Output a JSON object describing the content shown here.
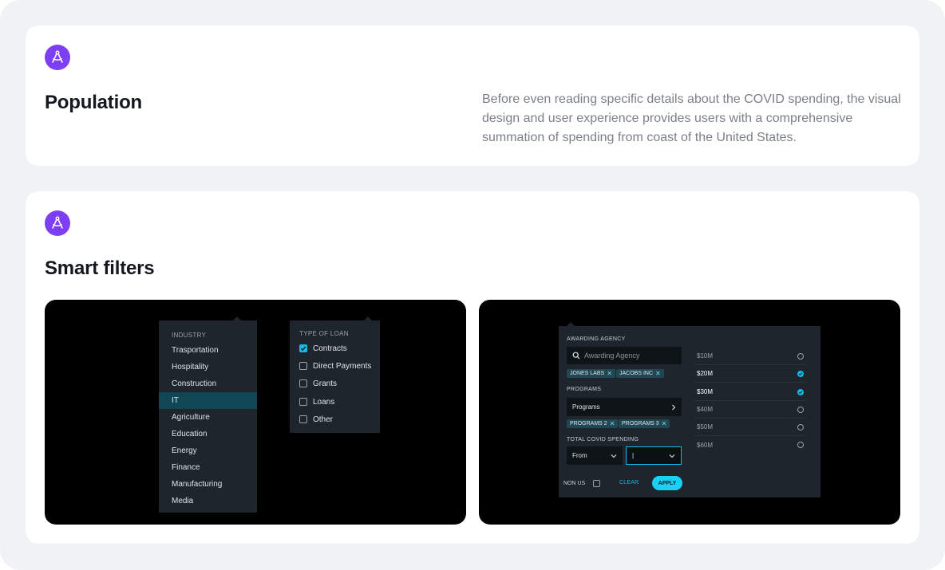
{
  "population": {
    "logo_icon": "compass-drafting-icon",
    "title": "Population",
    "description": "Before even reading specific details about the COVID spending, the visual design and user experience provides users with a comprehensive summation of spending from coast of the United States."
  },
  "smart_filters": {
    "logo_icon": "compass-drafting-icon",
    "title": "Smart filters"
  },
  "industry_dropdown": {
    "heading": "INDUSTRY",
    "items": [
      "Trasportation",
      "Hospitality",
      "Construction",
      "IT",
      "Agriculture",
      "Education",
      "Energy",
      "Finance",
      "Manufacturing",
      "Media"
    ],
    "active_item": "IT"
  },
  "loan_dropdown": {
    "heading": "TYPE OF LOAN",
    "options": [
      {
        "label": "Contracts",
        "checked": true
      },
      {
        "label": "Direct Payments",
        "checked": false
      },
      {
        "label": "Grants",
        "checked": false
      },
      {
        "label": "Loans",
        "checked": false
      },
      {
        "label": "Other",
        "checked": false
      }
    ]
  },
  "filter_panel": {
    "agency_label": "AWARDING AGENCY",
    "agency_placeholder": "Awarding Agency",
    "agency_tags": [
      "JONES LABS",
      "JACOBS INC"
    ],
    "programs_label": "PROGRAMS",
    "programs_select": "Programs",
    "program_tags": [
      "PROGRAMS 2",
      "PROGRAMS 3"
    ],
    "spending_label": "TOTAL COVID SPENDING",
    "from_select": "From",
    "to_value": "|",
    "non_us_label": "NON US",
    "clear_label": "CLEAR",
    "apply_label": "APPLY",
    "amounts": [
      {
        "label": "$10M",
        "selected": false
      },
      {
        "label": "$20M",
        "selected": true
      },
      {
        "label": "$30M",
        "selected": true
      },
      {
        "label": "$40M",
        "selected": false
      },
      {
        "label": "$50M",
        "selected": false
      },
      {
        "label": "$60M",
        "selected": false
      }
    ],
    "accent_color": "#18d1f5"
  }
}
